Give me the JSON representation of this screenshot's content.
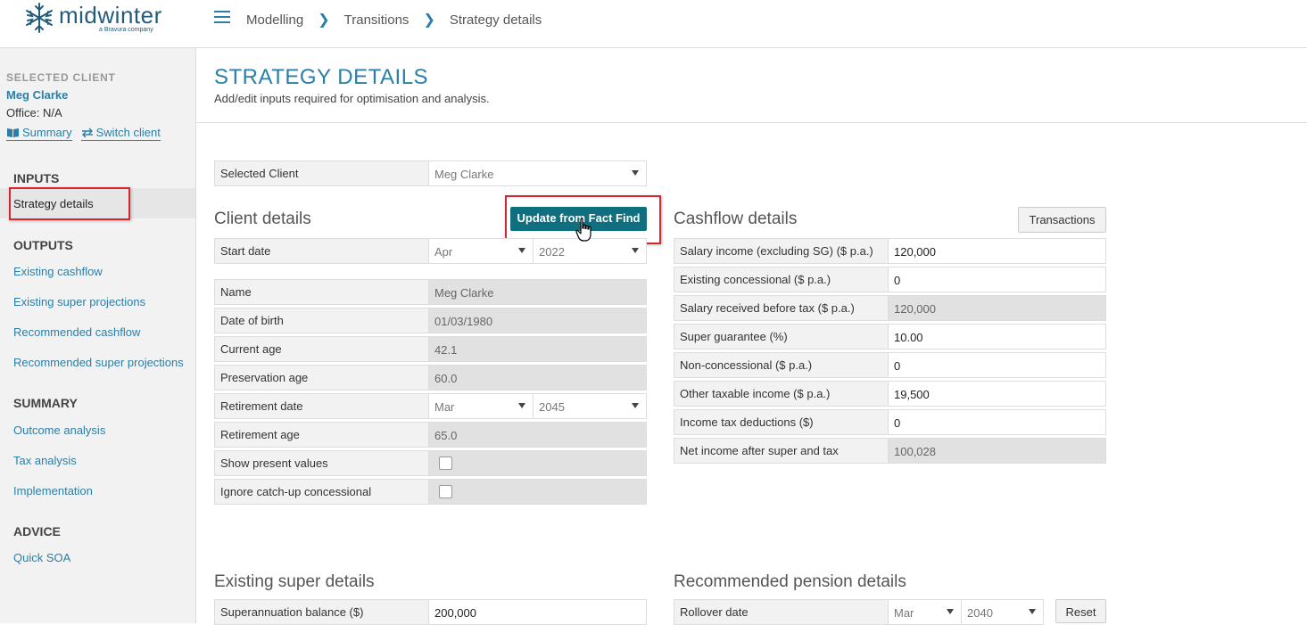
{
  "brand": {
    "name": "midwinter",
    "tagline": "a Bravura company"
  },
  "breadcrumb": [
    "Modelling",
    "Transitions",
    "Strategy details"
  ],
  "sidebar": {
    "selected_heading": "SELECTED CLIENT",
    "client_name": "Meg Clarke",
    "office": "Office: N/A",
    "summary_link": "Summary",
    "switch_link": "Switch client",
    "sections": {
      "inputs": "INPUTS",
      "outputs": "OUTPUTS",
      "summary": "SUMMARY",
      "advice": "ADVICE"
    },
    "inputs_items": [
      "Strategy details"
    ],
    "outputs_items": [
      "Existing cashflow",
      "Existing super projections",
      "Recommended cashflow",
      "Recommended super projections"
    ],
    "summary_items": [
      "Outcome analysis",
      "Tax analysis",
      "Implementation"
    ],
    "advice_items": [
      "Quick SOA"
    ]
  },
  "page": {
    "title": "STRATEGY DETAILS",
    "subtitle": "Add/edit inputs required for optimisation and analysis."
  },
  "selected_client": {
    "label": "Selected Client",
    "value": "Meg Clarke"
  },
  "client_details": {
    "title": "Client details",
    "update_button": "Update from Fact Find",
    "start_date": {
      "label": "Start date",
      "month": "Apr",
      "year": "2022"
    },
    "name": {
      "label": "Name",
      "value": "Meg Clarke"
    },
    "dob": {
      "label": "Date of birth",
      "value": "01/03/1980"
    },
    "current_age": {
      "label": "Current age",
      "value": "42.1"
    },
    "preservation_age": {
      "label": "Preservation age",
      "value": "60.0"
    },
    "retirement_date": {
      "label": "Retirement date",
      "month": "Mar",
      "year": "2045"
    },
    "retirement_age": {
      "label": "Retirement age",
      "value": "65.0"
    },
    "show_present": {
      "label": "Show present values",
      "checked": false
    },
    "ignore_catchup": {
      "label": "Ignore catch-up concessional",
      "checked": false
    }
  },
  "cashflow": {
    "title": "Cashflow details",
    "transactions_button": "Transactions",
    "rows": [
      {
        "label": "Salary income (excluding SG) ($ p.a.)",
        "value": "120,000",
        "readonly": false
      },
      {
        "label": "Existing concessional ($ p.a.)",
        "value": "0",
        "readonly": false
      },
      {
        "label": "Salary received before tax ($ p.a.)",
        "value": "120,000",
        "readonly": true
      },
      {
        "label": "Super guarantee (%)",
        "value": "10.00",
        "readonly": false
      },
      {
        "label": "Non-concessional ($ p.a.)",
        "value": "0",
        "readonly": false
      },
      {
        "label": "Other taxable income ($ p.a.)",
        "value": "19,500",
        "readonly": false
      },
      {
        "label": "Income tax deductions ($)",
        "value": "0",
        "readonly": false
      },
      {
        "label": "Net income after super and tax",
        "value": "100,028",
        "readonly": true
      }
    ]
  },
  "existing_super": {
    "title": "Existing super details",
    "balance": {
      "label": "Superannuation balance ($)",
      "value": "200,000"
    }
  },
  "recommended_pension": {
    "title": "Recommended pension details",
    "rollover": {
      "label": "Rollover date",
      "month": "Mar",
      "year": "2040"
    },
    "reset_button": "Reset"
  }
}
